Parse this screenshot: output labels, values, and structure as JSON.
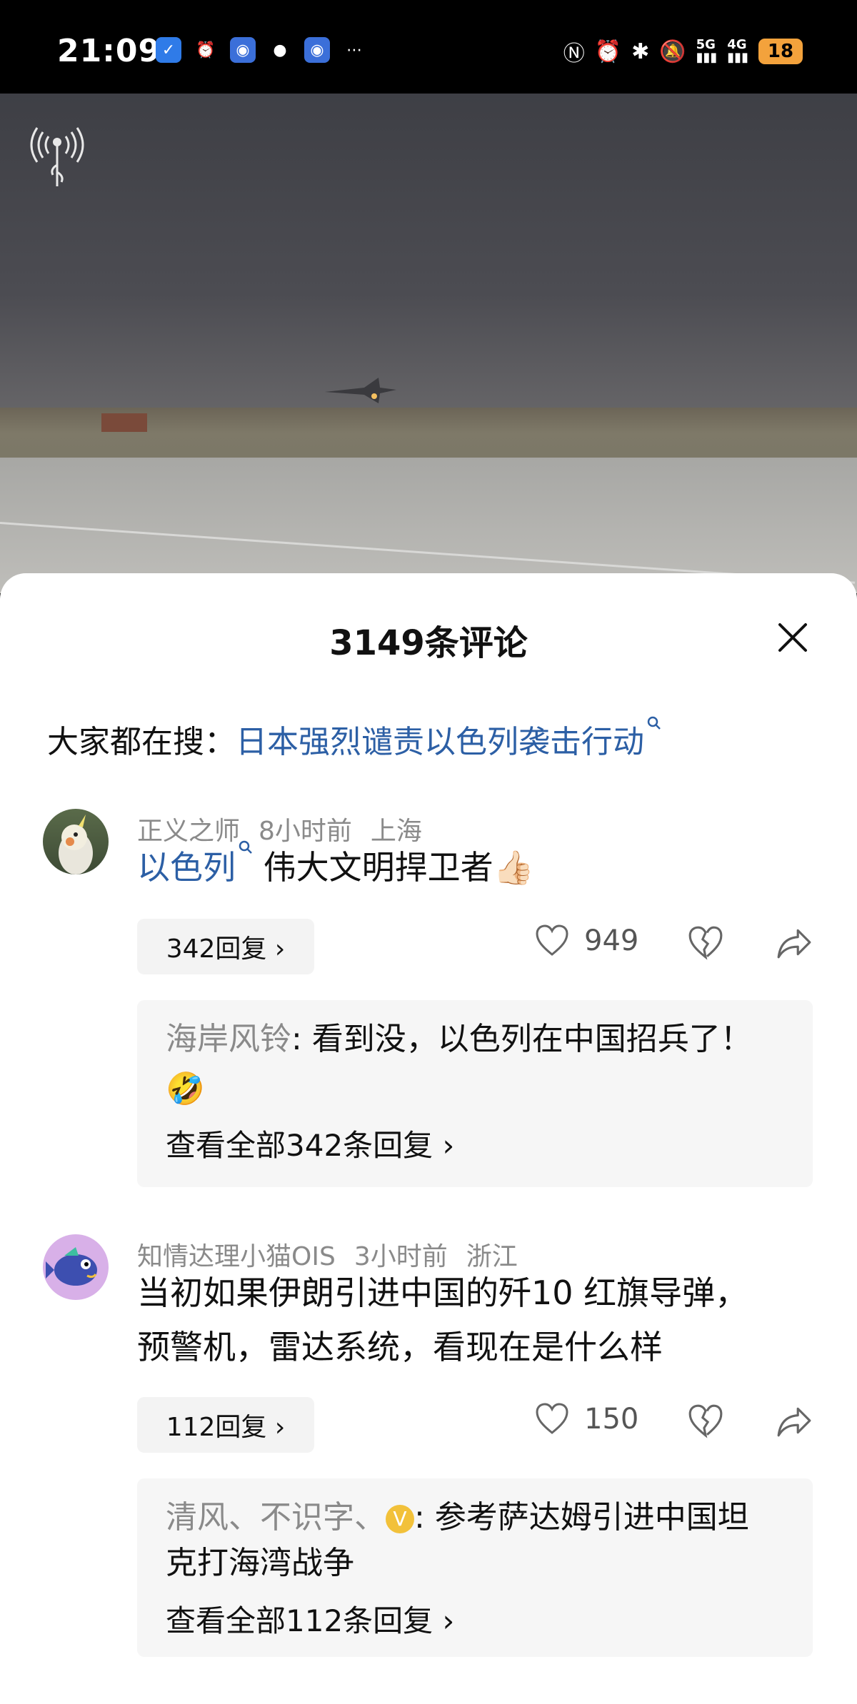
{
  "status_bar": {
    "time": "21:09",
    "sig5g": "5G",
    "sig4g": "4G",
    "battery": "18"
  },
  "comments_header": {
    "title": "3149条评论"
  },
  "trending": {
    "label": "大家都在搜：",
    "query": "日本强烈谴责以色列袭击行动"
  },
  "comments": [
    {
      "user": "正义之师",
      "time": "8小时前",
      "location": "上海",
      "text_link": "以色列",
      "text": " 伟大文明捍卫者",
      "emoji": "👍🏻",
      "replies_label": "342回复 ›",
      "likes": "949",
      "top_reply_user": "海岸风铃",
      "top_reply_text": ": 看到没，以色列在中国招兵了！",
      "top_reply_emoji": "🤣",
      "view_all": "查看全部342条回复 ›"
    },
    {
      "user": "知情达理小猫OIS",
      "time": "3小时前",
      "location": "浙江",
      "text_line1": "当初如果伊朗引进中国的歼10 红旗导弹，",
      "text_line2": "预警机，雷达系统，看现在是什么样",
      "replies_label": "112回复 ›",
      "likes": "150",
      "top_reply_user": "清风、不识字、",
      "top_reply_badge": "V",
      "top_reply_text_1": ": 参考萨达姆引进中国坦",
      "top_reply_text_2": "克打海湾战争",
      "view_all": "查看全部112条回复 ›"
    }
  ],
  "colors": {
    "link": "#2c5fa5",
    "battery": "#f3a23c"
  }
}
